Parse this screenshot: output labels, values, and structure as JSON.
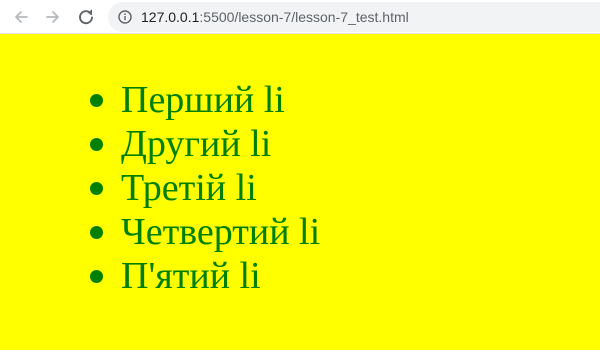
{
  "browser": {
    "url": {
      "host": "127.0.0.1",
      "path": ":5500/lesson-7/lesson-7_test.html"
    },
    "icons": {
      "back": "arrow-left-icon",
      "forward": "arrow-right-icon",
      "reload": "reload-icon",
      "info": "info-icon"
    }
  },
  "page": {
    "background_color": "#ffff00",
    "text_color": "#008000",
    "items": [
      {
        "label": "Перший li"
      },
      {
        "label": "Другий li"
      },
      {
        "label": "Третій li"
      },
      {
        "label": "Четвертий li"
      },
      {
        "label": "П'ятий li"
      }
    ]
  }
}
